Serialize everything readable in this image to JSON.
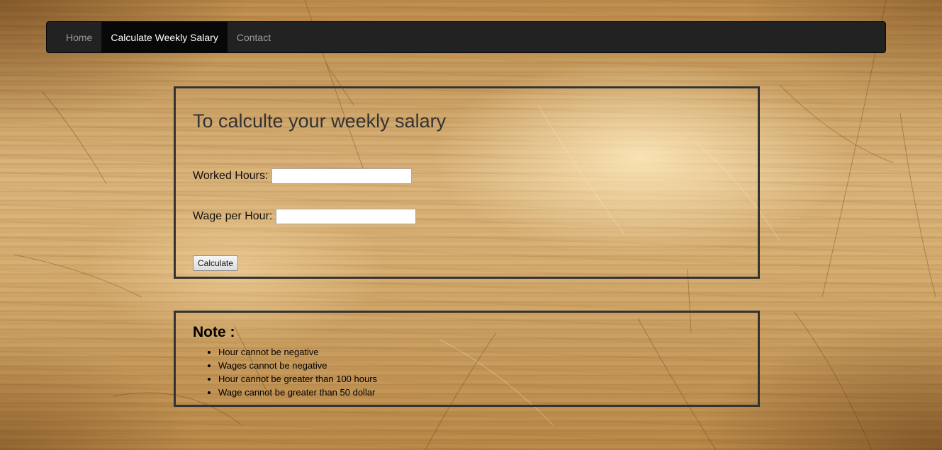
{
  "navbar": {
    "items": [
      {
        "label": "Home",
        "active": false
      },
      {
        "label": "Calculate Weekly Salary",
        "active": true
      },
      {
        "label": "Contact",
        "active": false
      }
    ]
  },
  "form": {
    "title": "To calculte your weekly salary",
    "hours_label": "Worked Hours:",
    "hours_value": "",
    "wage_label": "Wage per Hour:",
    "wage_value": "",
    "calculate_label": "Calculate"
  },
  "note": {
    "title": "Note :",
    "items": [
      "Hour cannot be negative",
      "Wages cannot be negative",
      "Hour cannot be greater than 100 hours",
      "Wage cannot be greater than 50 dollar"
    ]
  },
  "colors": {
    "navbar_bg": "#222222",
    "navbar_active_bg": "#080808",
    "panel_border": "#333333"
  }
}
